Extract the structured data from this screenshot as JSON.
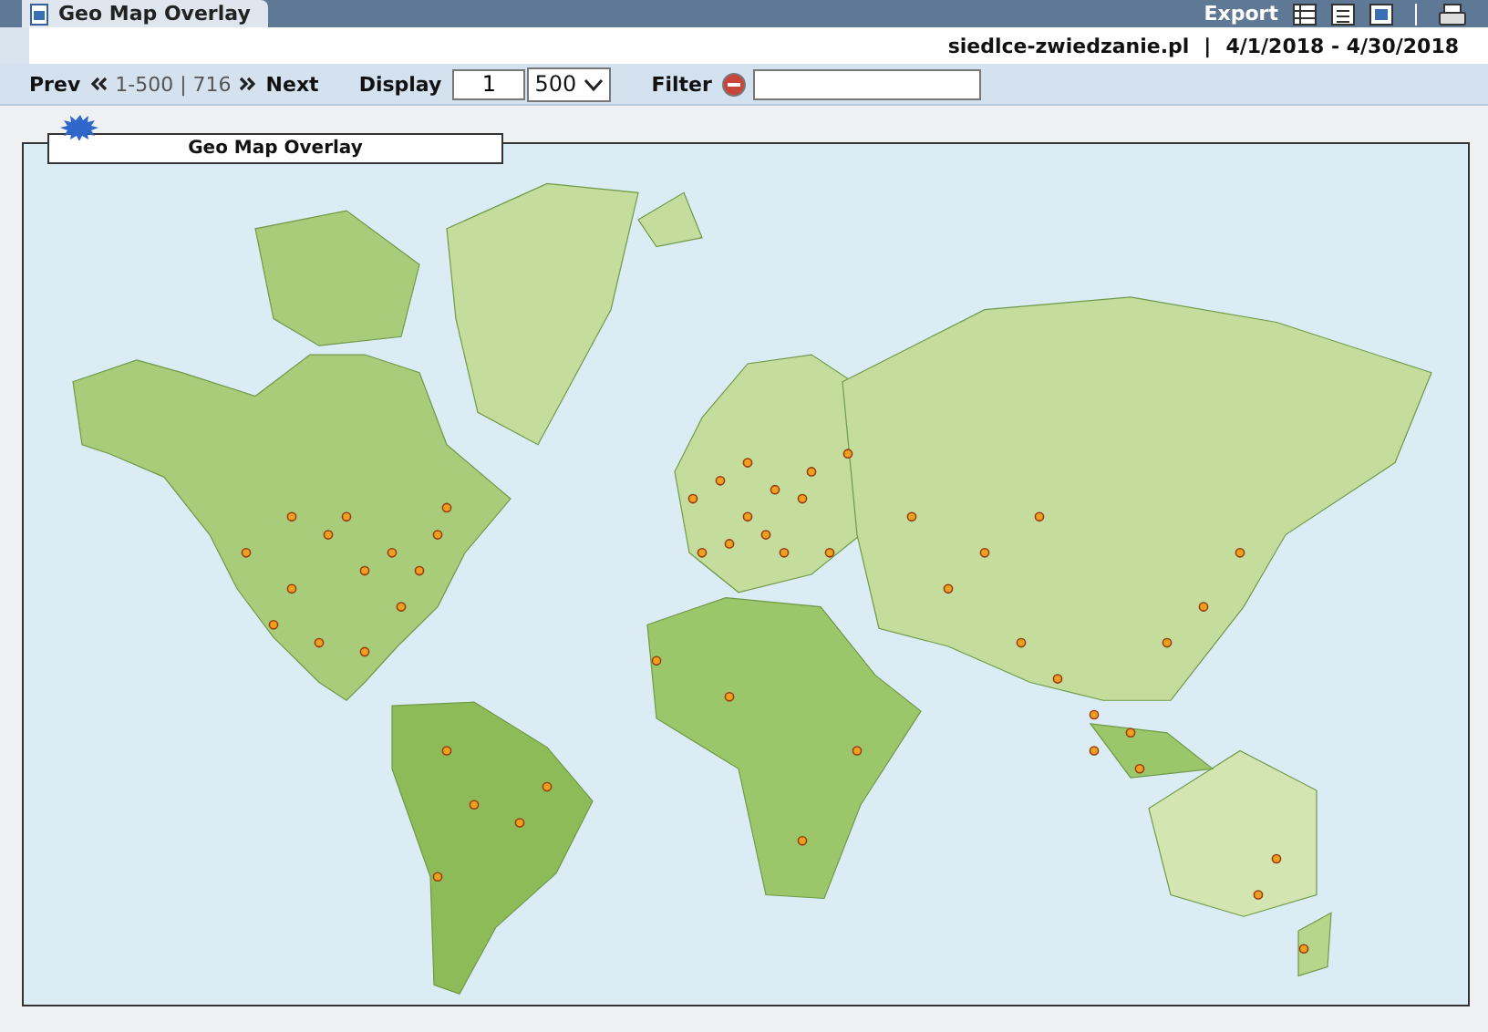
{
  "tab": {
    "label": "Geo Map Overlay",
    "selected": true
  },
  "export": {
    "label": "Export"
  },
  "site": "siedlce-zwiedzanie.pl",
  "separator": "|",
  "date_range": "4/1/2018 - 4/30/2018",
  "pager": {
    "prev": "Prev",
    "range": "1-500 | 716",
    "next": "Next"
  },
  "display": {
    "label": "Display",
    "value": "1",
    "page_size": "500"
  },
  "filter": {
    "label": "Filter"
  },
  "panel": {
    "title": "Geo Map Overlay"
  }
}
